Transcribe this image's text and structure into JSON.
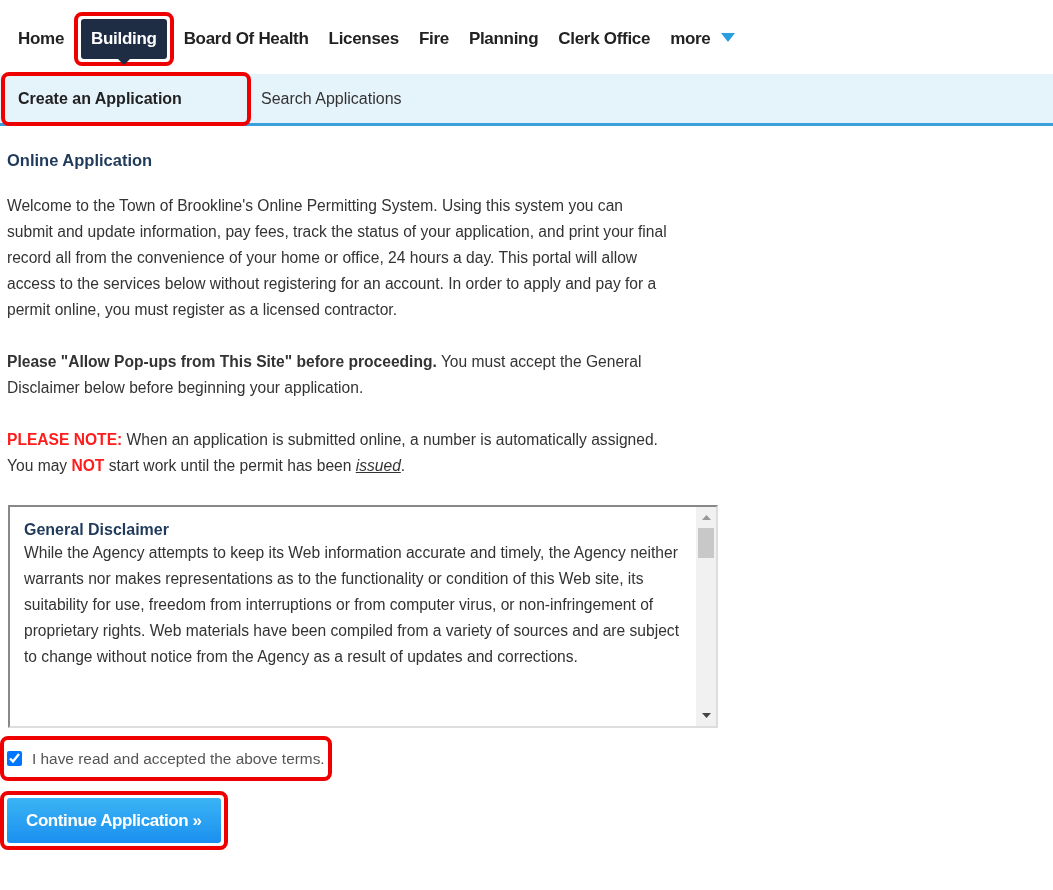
{
  "tabs": [
    {
      "label": "Home",
      "selected": false,
      "highlighted": false
    },
    {
      "label": "Building",
      "selected": true,
      "highlighted": true
    },
    {
      "label": "Board Of Health",
      "selected": false,
      "highlighted": false
    },
    {
      "label": "Licenses",
      "selected": false,
      "highlighted": false
    },
    {
      "label": "Fire",
      "selected": false,
      "highlighted": false
    },
    {
      "label": "Planning",
      "selected": false,
      "highlighted": false
    },
    {
      "label": "Clerk Office",
      "selected": false,
      "highlighted": false
    },
    {
      "label": "more",
      "selected": false,
      "highlighted": false,
      "kind": "dropdown"
    }
  ],
  "subtabs": [
    {
      "label": "Create an Application",
      "selected": true,
      "highlighted": true
    },
    {
      "label": "Search Applications",
      "selected": false,
      "highlighted": false
    }
  ],
  "heading": "Online Application",
  "paragraphs": [
    [
      {
        "kind": "plain",
        "text": "Welcome to the Town of Brookline's Online Permitting System. Using this system you can submit and update information, pay fees, track the status of your application, and print your final record all from the convenience of your home or office, 24 hours a day.   This portal will allow access to the services below without registering for an account. In order to apply and pay for a permit online, you must register as a licensed contractor."
      }
    ],
    [
      {
        "kind": "bold",
        "text": "Please \"Allow Pop-ups from This Site\" before proceeding."
      },
      {
        "kind": "plain",
        "text": " You must accept the General Disclaimer below before beginning your application."
      }
    ],
    [
      {
        "kind": "alert",
        "text": "PLEASE NOTE:"
      },
      {
        "kind": "plain",
        "text": " When an application is submitted online, a number is automatically assigned.  You may "
      },
      {
        "kind": "alert",
        "text": "NOT"
      },
      {
        "kind": "plain",
        "text": " start work until the permit has been "
      },
      {
        "kind": "emphasis",
        "text": "issued"
      },
      {
        "kind": "plain",
        "text": "."
      }
    ]
  ],
  "disclaimer": {
    "title": "General Disclaimer",
    "text": "While the Agency attempts to keep its Web information accurate and timely, the Agency neither warrants nor makes representations as to the functionality or condition of this Web site, its suitability for use, freedom from interruptions or from computer virus, or non-infringement of proprietary rights. Web materials have been compiled from a variety of sources and are subject to change without notice from the Agency as a result of updates and corrections."
  },
  "accept": {
    "label": "I have read and accepted the above terms.",
    "checked": true,
    "highlighted": true
  },
  "continue_button": {
    "label": "Continue Application »",
    "highlighted": true
  }
}
